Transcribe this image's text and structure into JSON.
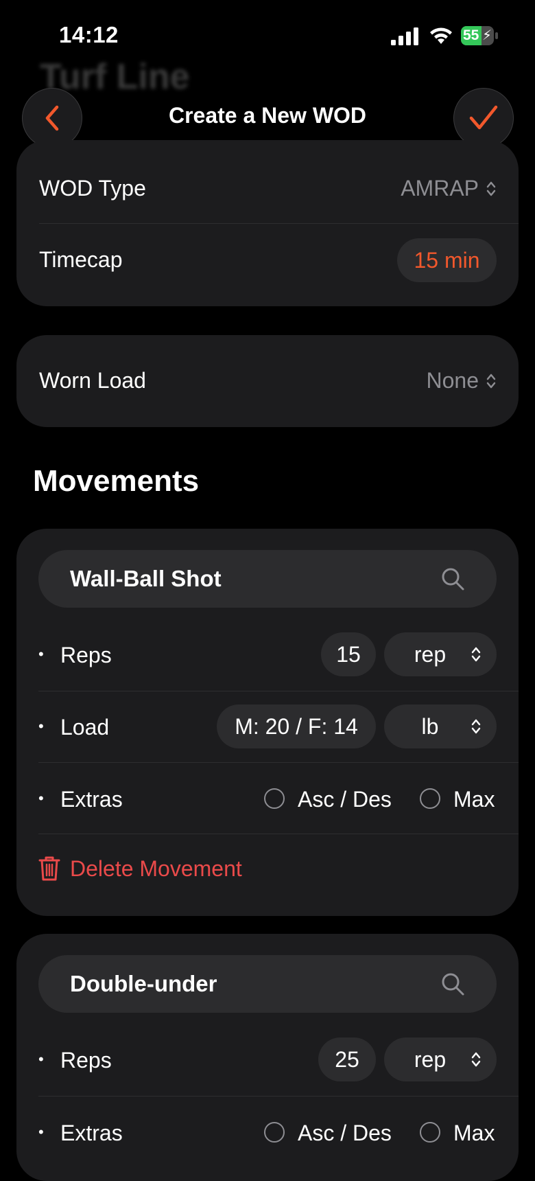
{
  "status": {
    "time": "14:12",
    "battery": "55"
  },
  "background_title": "Turf Line",
  "nav": {
    "title": "Create a New WOD"
  },
  "wod": {
    "type_label": "WOD Type",
    "type_value": "AMRAP",
    "timecap_label": "Timecap",
    "timecap_value": "15 min"
  },
  "load": {
    "label": "Worn Load",
    "value": "None"
  },
  "movements_title": "Movements",
  "movements": [
    {
      "name": "Wall-Ball Shot",
      "reps_label": "Reps",
      "reps_value": "15",
      "reps_unit": "rep",
      "load_label": "Load",
      "load_value": "M: 20 / F: 14",
      "load_unit": "lb",
      "extras_label": "Extras",
      "opt1": "Asc / Des",
      "opt2": "Max",
      "delete_label": "Delete Movement"
    },
    {
      "name": "Double-under",
      "reps_label": "Reps",
      "reps_value": "25",
      "reps_unit": "rep",
      "extras_label": "Extras",
      "opt1": "Asc / Des",
      "opt2": "Max"
    }
  ],
  "colors": {
    "accent": "#f2582c",
    "danger": "#ea4a4a",
    "card": "#1c1c1e",
    "pill": "#2c2c2e"
  }
}
